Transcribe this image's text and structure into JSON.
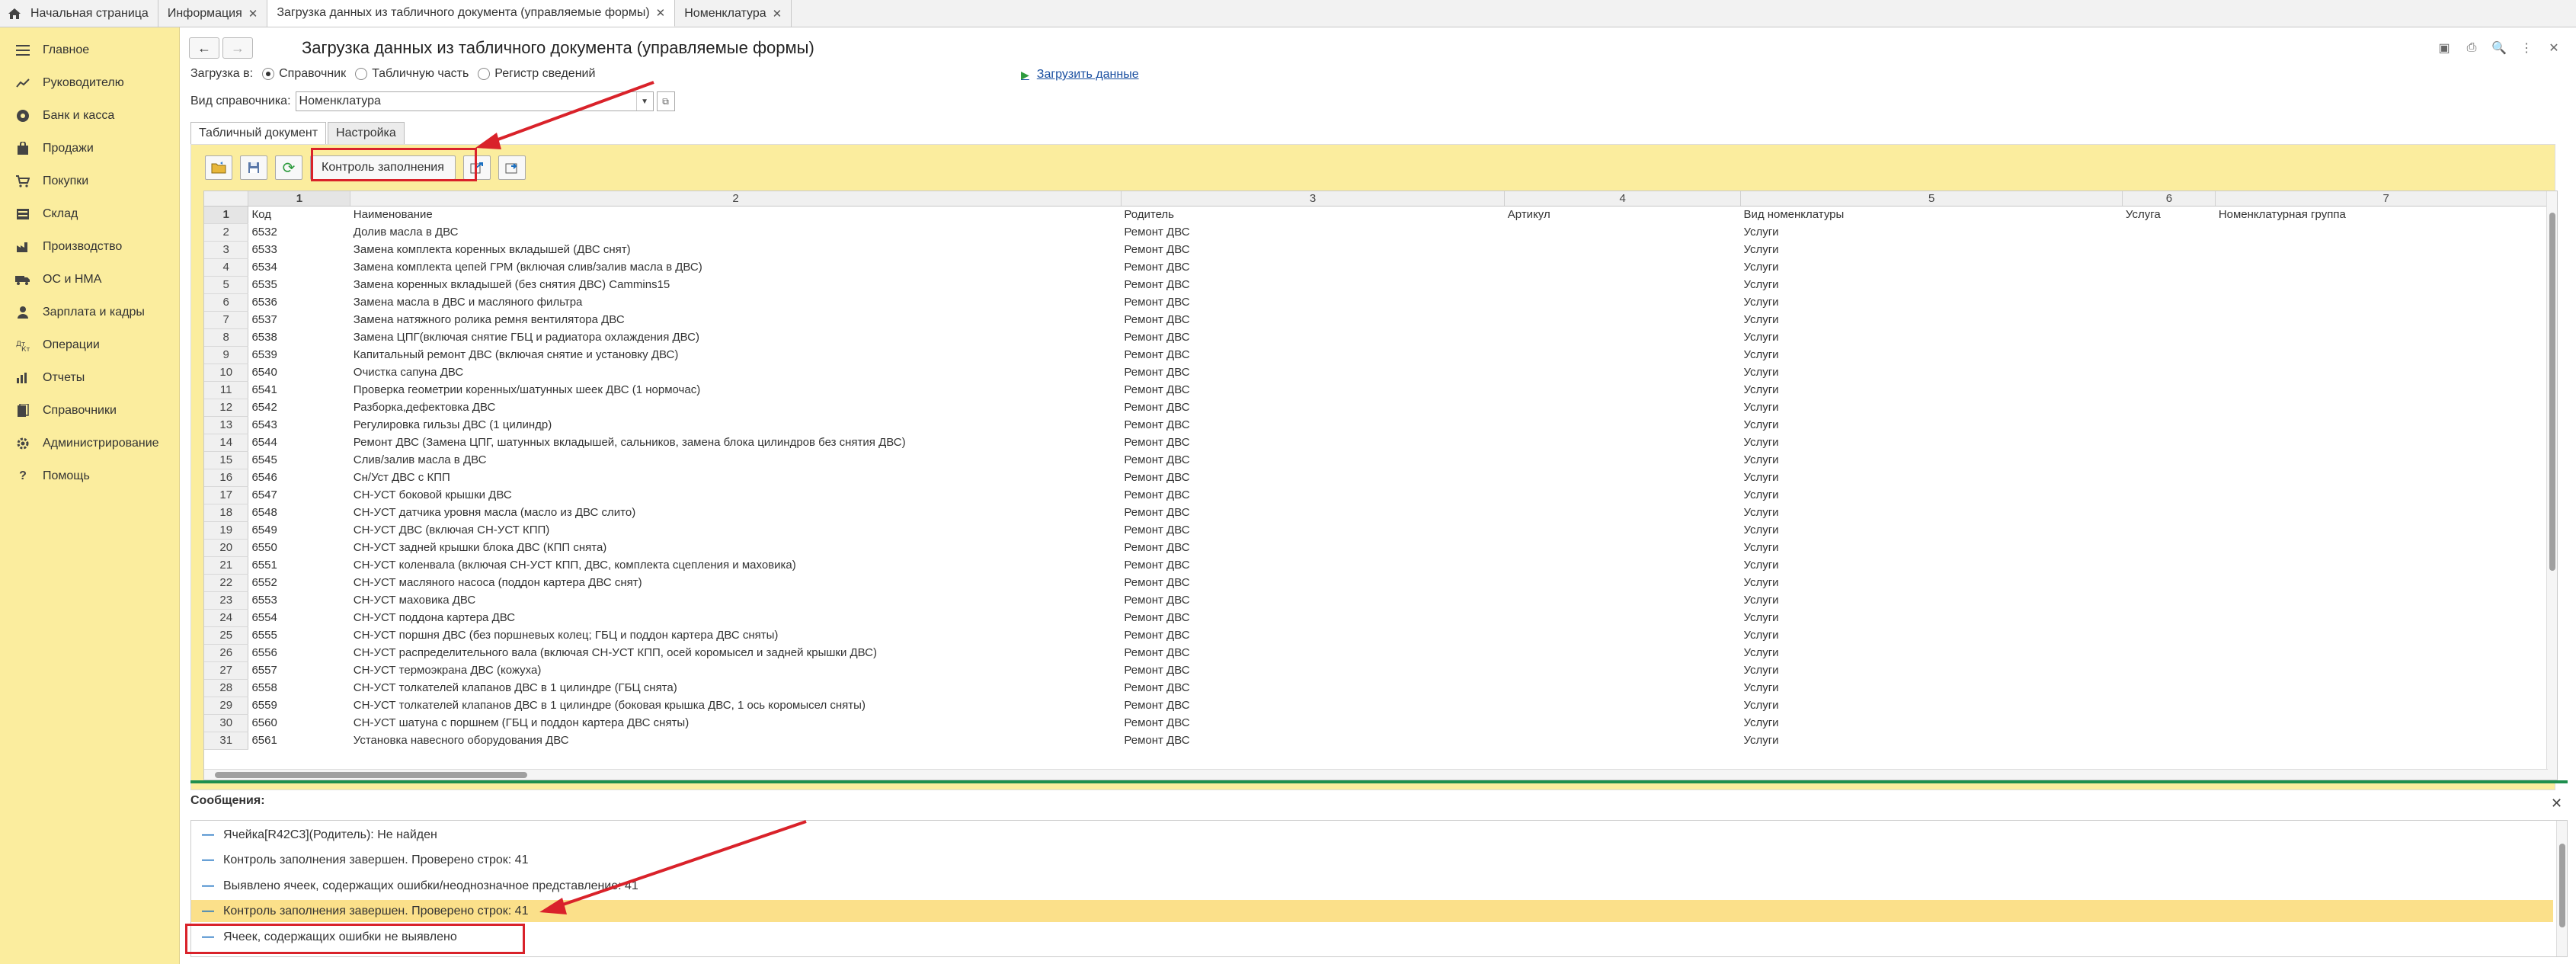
{
  "top_tabs": [
    {
      "label": "Начальная страница",
      "active": false,
      "closable": false
    },
    {
      "label": "Информация",
      "active": false,
      "closable": true
    },
    {
      "label": "Загрузка данных из табличного документа (управляемые формы)",
      "active": true,
      "closable": true
    },
    {
      "label": "Номенклатура",
      "active": false,
      "closable": true
    }
  ],
  "sidebar": {
    "items": [
      {
        "label": "Главное",
        "icon": "menu-icon"
      },
      {
        "label": "Руководителю",
        "icon": "trend-icon"
      },
      {
        "label": "Банк и касса",
        "icon": "bank-icon"
      },
      {
        "label": "Продажи",
        "icon": "bag-icon"
      },
      {
        "label": "Покупки",
        "icon": "cart-icon"
      },
      {
        "label": "Склад",
        "icon": "warehouse-icon"
      },
      {
        "label": "Производство",
        "icon": "factory-icon"
      },
      {
        "label": "ОС и НМА",
        "icon": "truck-icon"
      },
      {
        "label": "Зарплата и кадры",
        "icon": "person-icon"
      },
      {
        "label": "Операции",
        "icon": "operations-icon"
      },
      {
        "label": "Отчеты",
        "icon": "chart-icon"
      },
      {
        "label": "Справочники",
        "icon": "books-icon"
      },
      {
        "label": "Администрирование",
        "icon": "gear-icon"
      },
      {
        "label": "Помощь",
        "icon": "question-icon"
      }
    ]
  },
  "header": {
    "back": "←",
    "forward": "→",
    "title": "Загрузка данных из табличного документа (управляемые формы)",
    "right_icons": [
      "save-icon",
      "print-icon",
      "preview-icon",
      "more-icon",
      "close-icon"
    ],
    "right_glyphs": [
      "▣",
      "⎙",
      "🔍",
      "⋮",
      "✕"
    ]
  },
  "load_into": {
    "label": "Загрузка в:",
    "options": [
      {
        "label": "Справочник",
        "selected": true
      },
      {
        "label": "Табличную часть",
        "selected": false
      },
      {
        "label": "Регистр сведений",
        "selected": false
      }
    ],
    "load_link": "Загрузить данные"
  },
  "catalog_kind": {
    "label": "Вид справочника:",
    "value": "Номенклатура"
  },
  "inner_tabs": [
    {
      "label": "Табличный документ",
      "active": true
    },
    {
      "label": "Настройка",
      "active": false
    }
  ],
  "toolbar": {
    "fill_check": "Контроль заполнения"
  },
  "sheet": {
    "col_numbers": [
      "1",
      "2",
      "3",
      "4",
      "5",
      "6",
      "7"
    ],
    "rows": [
      [
        "Код",
        "Наименование",
        "Родитель",
        "Артикул",
        "Вид номенклатуры",
        "Услуга",
        "Номенклатурная группа"
      ],
      [
        "6532",
        "Долив масла в ДВС",
        "Ремонт ДВС",
        "",
        "Услуги",
        "",
        ""
      ],
      [
        "6533",
        "Замена комплекта коренных вкладышей (ДВС снят)",
        "Ремонт ДВС",
        "",
        "Услуги",
        "",
        ""
      ],
      [
        "6534",
        "Замена комплекта цепей ГРМ  (включая слив/залив масла в ДВС)",
        "Ремонт ДВС",
        "",
        "Услуги",
        "",
        ""
      ],
      [
        "6535",
        "Замена коренных вкладышей (без снятия ДВС) Cammins15",
        "Ремонт ДВС",
        "",
        "Услуги",
        "",
        ""
      ],
      [
        "6536",
        "Замена масла в ДВС и масляного фильтра",
        "Ремонт ДВС",
        "",
        "Услуги",
        "",
        ""
      ],
      [
        "6537",
        "Замена натяжного ролика ремня вентилятора ДВС",
        "Ремонт ДВС",
        "",
        "Услуги",
        "",
        ""
      ],
      [
        "6538",
        "Замена ЦПГ(включая снятие ГБЦ и радиатора охлаждения ДВС)",
        "Ремонт ДВС",
        "",
        "Услуги",
        "",
        ""
      ],
      [
        "6539",
        "Капитальный ремонт ДВС (включая снятие и установку ДВС)",
        "Ремонт ДВС",
        "",
        "Услуги",
        "",
        ""
      ],
      [
        "6540",
        "Очистка сапуна ДВС",
        "Ремонт ДВС",
        "",
        "Услуги",
        "",
        ""
      ],
      [
        "6541",
        "Проверка геометрии коренных/шатунных шеек ДВС (1 нормочас)",
        "Ремонт ДВС",
        "",
        "Услуги",
        "",
        ""
      ],
      [
        "6542",
        "Разборка,дефектовка ДВС",
        "Ремонт ДВС",
        "",
        "Услуги",
        "",
        ""
      ],
      [
        "6543",
        "Регулировка гильзы ДВС (1 цилиндр)",
        "Ремонт ДВС",
        "",
        "Услуги",
        "",
        ""
      ],
      [
        "6544",
        "Ремонт ДВС (Замена ЦПГ, шатунных вкладышей, сальников, замена блока цилиндров без снятия ДВС)",
        "Ремонт ДВС",
        "",
        "Услуги",
        "",
        ""
      ],
      [
        "6545",
        "Слив/залив масла в ДВС",
        "Ремонт ДВС",
        "",
        "Услуги",
        "",
        ""
      ],
      [
        "6546",
        "Сн/Уст ДВС с КПП",
        "Ремонт ДВС",
        "",
        "Услуги",
        "",
        ""
      ],
      [
        "6547",
        "СН-УСТ боковой крышки ДВС",
        "Ремонт ДВС",
        "",
        "Услуги",
        "",
        ""
      ],
      [
        "6548",
        "СН-УСТ датчика уровня масла (масло из ДВС слито)",
        "Ремонт ДВС",
        "",
        "Услуги",
        "",
        ""
      ],
      [
        "6549",
        "СН-УСТ ДВС (включая СН-УСТ КПП)",
        "Ремонт ДВС",
        "",
        "Услуги",
        "",
        ""
      ],
      [
        "6550",
        "СН-УСТ задней крышки блока ДВС (КПП снята)",
        "Ремонт ДВС",
        "",
        "Услуги",
        "",
        ""
      ],
      [
        "6551",
        "СН-УСТ коленвала (включая СН-УСТ КПП, ДВС, комплекта сцепления и маховика)",
        "Ремонт ДВС",
        "",
        "Услуги",
        "",
        ""
      ],
      [
        "6552",
        "СН-УСТ масляного насоса (поддон картера ДВС снят)",
        "Ремонт ДВС",
        "",
        "Услуги",
        "",
        ""
      ],
      [
        "6553",
        "СН-УСТ маховика ДВС",
        "Ремонт ДВС",
        "",
        "Услуги",
        "",
        ""
      ],
      [
        "6554",
        "СН-УСТ поддона картера ДВС",
        "Ремонт ДВС",
        "",
        "Услуги",
        "",
        ""
      ],
      [
        "6555",
        "СН-УСТ поршня ДВС (без поршневых колец; ГБЦ и поддон картера ДВС сняты)",
        "Ремонт ДВС",
        "",
        "Услуги",
        "",
        ""
      ],
      [
        "6556",
        "СН-УСТ распределительного вала (включая СН-УСТ КПП, осей коромысел и задней крышки ДВС)",
        "Ремонт ДВС",
        "",
        "Услуги",
        "",
        ""
      ],
      [
        "6557",
        "СН-УСТ термоэкрана ДВС (кожуха)",
        "Ремонт ДВС",
        "",
        "Услуги",
        "",
        ""
      ],
      [
        "6558",
        "СН-УСТ толкателей клапанов ДВС в 1 цилиндре  (ГБЦ снята)",
        "Ремонт ДВС",
        "",
        "Услуги",
        "",
        ""
      ],
      [
        "6559",
        "СН-УСТ толкателей клапанов ДВС в 1 цилиндре  (боковая крышка ДВС, 1 ось коромысел сняты)",
        "Ремонт ДВС",
        "",
        "Услуги",
        "",
        ""
      ],
      [
        "6560",
        "СН-УСТ шатуна с поршнем (ГБЦ и поддон картера ДВС сняты)",
        "Ремонт ДВС",
        "",
        "Услуги",
        "",
        ""
      ],
      [
        "6561",
        "Установка навесного оборудования ДВС",
        "Ремонт ДВС",
        "",
        "Услуги",
        "",
        ""
      ]
    ]
  },
  "messages": {
    "title": "Сообщения:",
    "items": [
      {
        "text": "Ячейка[R42C3](Родитель): Не найден",
        "highlight": false
      },
      {
        "text": "Контроль заполнения завершен. Проверено строк: 41",
        "highlight": false
      },
      {
        "text": "Выявлено ячеек, содержащих ошибки/неоднозначное представление: 41",
        "highlight": false
      },
      {
        "text": "Контроль заполнения завершен. Проверено строк: 41",
        "highlight": true
      },
      {
        "text": "Ячеек, содержащих ошибки не выявлено",
        "highlight": false
      }
    ]
  },
  "colors": {
    "sidebar_bg": "#fbed9e",
    "annotation_red": "#d9222a",
    "divider_green": "#1e8f4e",
    "link_blue": "#1a4fa0"
  }
}
